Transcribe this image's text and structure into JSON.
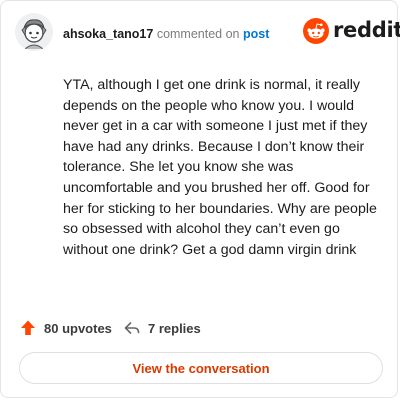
{
  "comment": {
    "username": "ahsoka_tano17",
    "commented_on_text": "commented on",
    "post_link_text": "post",
    "body": "YTA, although I get one drink is normal, it really depends on the people who know you. I would never get in a car with someone I just met if they have had any drinks. Because I don’t know their tolerance. She let you know she was uncomfortable and you brushed her off. Good for her for sticking to her boundaries. Why are people so obsessed with alcohol they can’t even go without one drink? Get a god damn virgin drink",
    "upvotes_label": "80 upvotes",
    "replies_label": "7 replies"
  },
  "brand": {
    "logo_text": "reddit",
    "icon": "reddit-snoo-icon",
    "accent_color": "#ff4500"
  },
  "footer": {
    "view_conversation_label": "View the conversation",
    "button_text_color": "#d93a00"
  },
  "icons": {
    "avatar": "avatar-illustration",
    "upvote": "upvote-arrow-icon",
    "reply": "reply-arrow-icon"
  }
}
